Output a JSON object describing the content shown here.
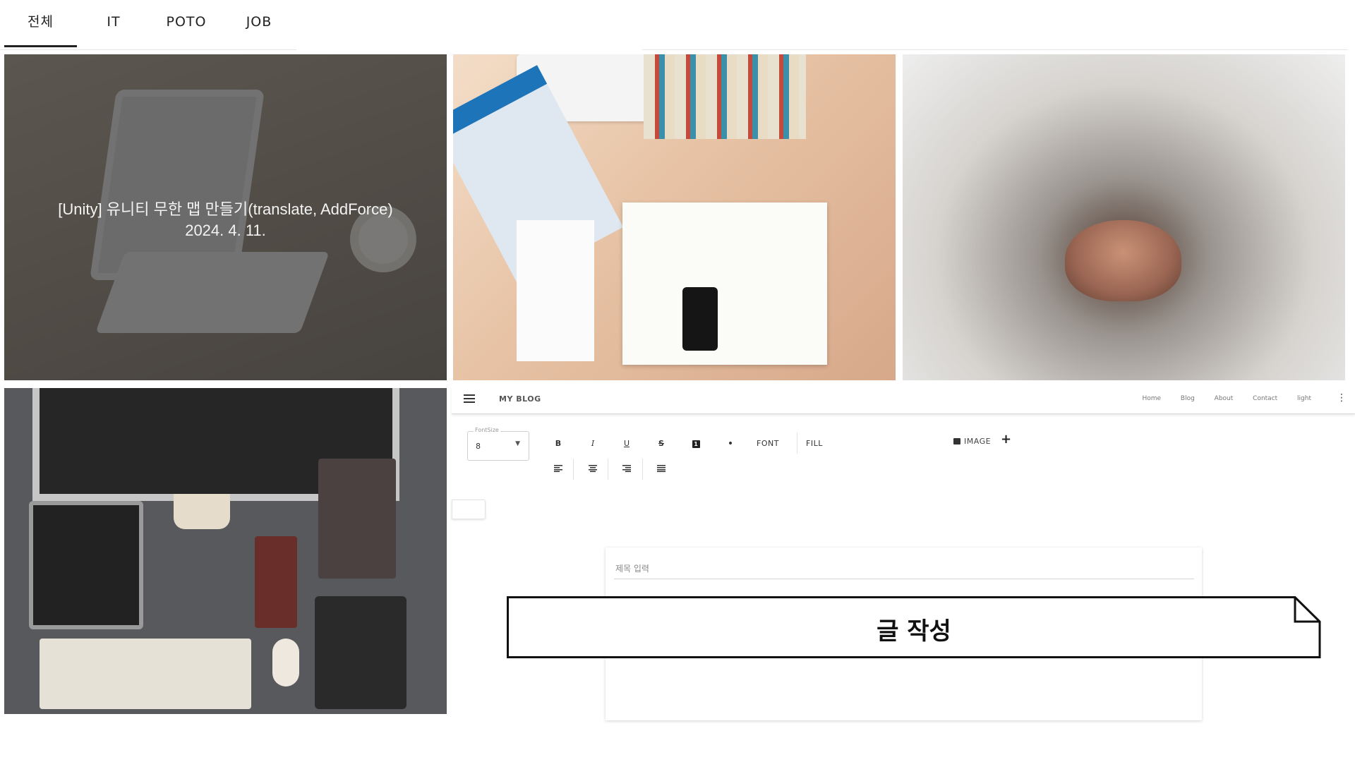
{
  "tabs": [
    {
      "label": "전체",
      "active": true
    },
    {
      "label": "IT",
      "active": false
    },
    {
      "label": "POTO",
      "active": false
    },
    {
      "label": "JOB",
      "active": false
    }
  ],
  "posts": [
    {
      "title": "[Unity] 유니티 무한 맵 만들기(translate, AddForce)",
      "date": "2024. 4. 11.",
      "image": "laptop-on-desk",
      "hovered": true
    },
    {
      "image": "desk-flatlay-with-books"
    },
    {
      "image": "cat-nose-closeup"
    },
    {
      "image": "workspace-devices"
    }
  ],
  "blog": {
    "brand": "MY BLOG",
    "nav": [
      "Home",
      "Blog",
      "About",
      "Contact",
      "light"
    ],
    "fontsize_label": "FontSize",
    "fontsize_value": "8",
    "toolbar": {
      "bold": "B",
      "italic": "I",
      "underline": "U",
      "strike": "S",
      "numbered": "1",
      "bullet": "•",
      "font": "FONT",
      "fill": "FILL",
      "image": "IMAGE",
      "add": "+"
    },
    "title_placeholder": "제목 입력",
    "banner": "글 작성"
  }
}
